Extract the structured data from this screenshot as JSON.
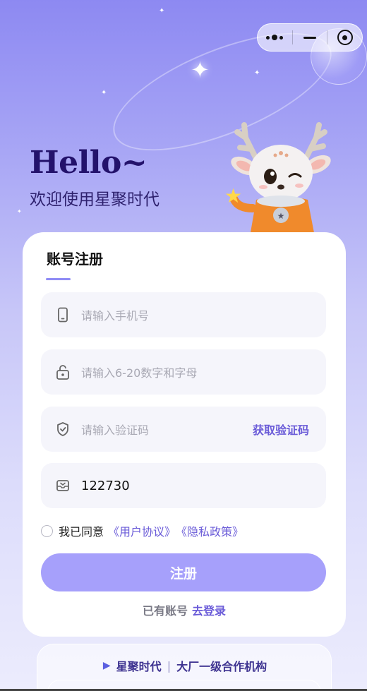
{
  "capsule": {
    "more_icon": "more-dots-icon",
    "minimize_icon": "minus-icon",
    "close_icon": "target-circle-icon"
  },
  "hero": {
    "greeting": "Hello~",
    "welcome": "欢迎使用星聚时代"
  },
  "form": {
    "title": "账号注册",
    "phone": {
      "placeholder": "请输入手机号",
      "icon": "phone-icon"
    },
    "password": {
      "placeholder": "请输入6-20数字和字母",
      "icon": "lock-icon"
    },
    "code": {
      "placeholder": "请输入验证码",
      "icon": "shield-icon",
      "action": "获取验证码"
    },
    "invite": {
      "value": "122730",
      "icon": "inbox-icon"
    },
    "agreement": {
      "prefix": "我已同意",
      "terms": "《用户协议》",
      "privacy": "《隐私政策》",
      "checked": false
    },
    "submit_label": "注册",
    "login_prompt": "已有账号",
    "login_link": "去登录"
  },
  "partner": {
    "brand": "星聚时代",
    "tagline": "大厂一级合作机构",
    "icon": "play-triangle-icon"
  },
  "colors": {
    "accent": "#6a5bd8",
    "button": "#a6a0fb",
    "title": "#23126b"
  }
}
